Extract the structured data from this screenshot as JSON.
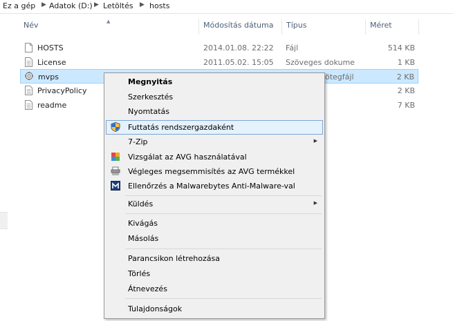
{
  "breadcrumb": {
    "items": [
      "Ez a gép",
      "Adatok (D:)",
      "Letöltés",
      "hosts"
    ]
  },
  "columns": {
    "name": "Név",
    "date": "Módosítás dátuma",
    "type": "Típus",
    "size": "Méret"
  },
  "files": [
    {
      "name": "HOSTS",
      "date": "2014.01.08. 22:22",
      "type": "Fájl",
      "size": "514 KB"
    },
    {
      "name": "License",
      "date": "2011.05.02. 15:05",
      "type": "Szöveges dokume...",
      "size": "1 KB"
    },
    {
      "name": "mvps",
      "date": "",
      "type": "ötegfájl",
      "size": "2 KB"
    },
    {
      "name": "PrivacyPolicy",
      "date": "",
      "type": "",
      "size": "2 KB"
    },
    {
      "name": "readme",
      "date": "",
      "type": "",
      "size": "7 KB"
    }
  ],
  "context_menu": {
    "open": "Megnyitás",
    "edit": "Szerkesztés",
    "print": "Nyomtatás",
    "run_as_admin": "Futtatás rendszergazdaként",
    "seven_zip": "7-Zip",
    "avg_scan": "Vizsgálat az AVG használatával",
    "avg_shred": "Végleges megsemmisítés az AVG termékkel",
    "malwarebytes": "Ellenőrzés a Malwarebytes Anti-Malware-val",
    "send_to": "Küldés",
    "cut": "Kivágás",
    "copy": "Másolás",
    "create_shortcut": "Parancsikon létrehozása",
    "delete": "Törlés",
    "rename": "Átnevezés",
    "properties": "Tulajdonságok"
  },
  "icons": {
    "uac_shield": "uac-shield-icon",
    "avg": "avg-icon",
    "shredder": "shredder-icon",
    "malwarebytes": "malwarebytes-icon",
    "submenu_arrow": "submenu-arrow-icon"
  },
  "colors": {
    "selection_bg": "#cce8ff",
    "selection_border": "#99d1ff",
    "menu_bg": "#f0f0f0",
    "menu_highlight": "#e5f1fb",
    "header_text": "#4c607a"
  }
}
